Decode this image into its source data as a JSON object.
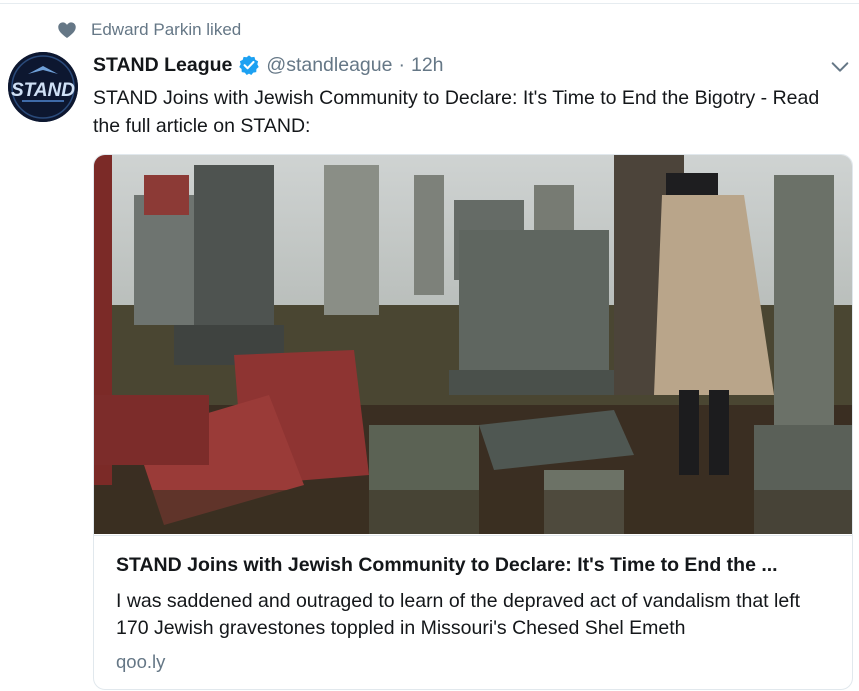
{
  "context": {
    "icon": "heart-icon",
    "text": "Edward Parkin liked"
  },
  "tweet": {
    "avatar_text": "STAND",
    "name": "STAND League",
    "verified": true,
    "handle": "@standleague",
    "separator": "·",
    "time": "12h",
    "text": "STAND Joins with Jewish Community to Declare: It's Time to End the Bigotry - Read the full article on STAND:"
  },
  "card": {
    "title": "STAND Joins with Jewish Community to Declare: It's Time to End the ...",
    "description": "I was saddened and outraged to learn of the depraved act of vandalism that left 170 Jewish gravestones toppled in Missouri's Chesed Shel Emeth",
    "domain": "qoo.ly"
  },
  "colors": {
    "secondary_text": "#657786",
    "verified_blue": "#1da1f2",
    "border": "#e1e8ed"
  }
}
